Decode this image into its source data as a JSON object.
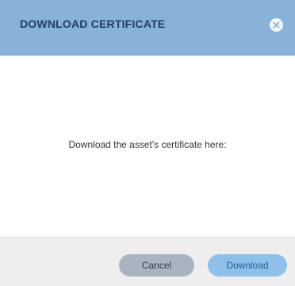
{
  "dialog": {
    "title": "DOWNLOAD CERTIFICATE",
    "close_icon": "close-icon",
    "message": "Download the asset's certificate here:",
    "buttons": {
      "cancel_label": "Cancel",
      "download_label": "Download"
    }
  },
  "colors": {
    "header_bg": "#89b2d8",
    "title_text": "#1f3f63",
    "cancel_bg": "#a9b4bf",
    "download_bg": "#8fc0ea"
  }
}
